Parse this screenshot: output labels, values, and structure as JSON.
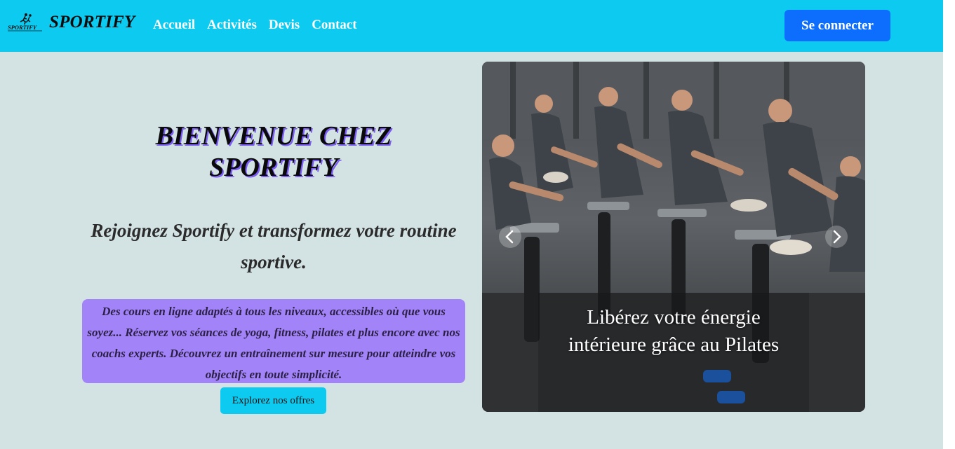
{
  "navbar": {
    "brand_name": "SPORTIFY",
    "logo_text": "SPORTIFY",
    "links": [
      {
        "label": "Accueil"
      },
      {
        "label": "Activités"
      },
      {
        "label": "Devis"
      },
      {
        "label": "Contact"
      }
    ],
    "login_label": "Se connecter"
  },
  "hero": {
    "title": "BIENVENUE CHEZ SPORTIFY",
    "subtitle": "Rejoignez Sportify et transformez votre routine sportive.",
    "description": "Des cours en ligne adaptés à tous les niveaux, accessibles où que vous soyez... Réservez vos séances de yoga, fitness, pilates et plus encore avec nos coachs experts. Découvrez un entraînement sur mesure pour atteindre vos objectifs en toute simplicité.",
    "cta_label": "Explorez nos offres"
  },
  "carousel": {
    "caption": "Libérez votre énergie intérieure grâce au Pilates",
    "prev_icon": "chevron-left-icon",
    "next_icon": "chevron-right-icon"
  },
  "colors": {
    "navbar_bg": "#0dcaf0",
    "page_bg": "#d3e2e3",
    "login_btn": "#0d6efd",
    "desc_bg": "#a384f8",
    "cta_btn": "#0dcaf0"
  }
}
